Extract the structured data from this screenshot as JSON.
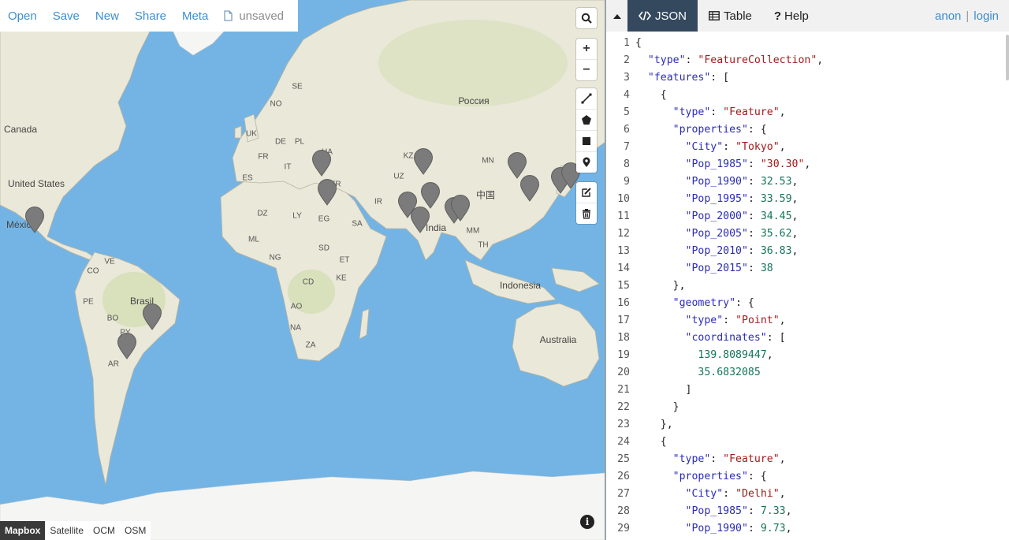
{
  "menu": {
    "items": [
      "Open",
      "Save",
      "New",
      "Share",
      "Meta"
    ],
    "doc_status": "unsaved"
  },
  "map": {
    "labels": [
      "Россия",
      "Canada",
      "United States",
      "México",
      "Brasil",
      "India",
      "中国",
      "Indonesia",
      "Australia",
      "SE",
      "NO",
      "UK",
      "DE",
      "PL",
      "UA",
      "FR",
      "ES",
      "IT",
      "TR",
      "KZ",
      "UZ",
      "MN",
      "IR",
      "DZ",
      "LY",
      "EG",
      "SA",
      "ML",
      "NG",
      "SD",
      "ET",
      "CD",
      "KE",
      "AO",
      "NA",
      "ZA",
      "VE",
      "CO",
      "PE",
      "BO",
      "PY",
      "AR",
      "MM",
      "TH"
    ],
    "base_layers": [
      "Mapbox",
      "Satellite",
      "OCM",
      "OSM"
    ],
    "active_layer": "Mapbox",
    "marker_color": "#7b7b7b",
    "water_color": "#74b4e4",
    "zoom_in": "+",
    "zoom_out": "−",
    "info": "i"
  },
  "panel": {
    "tabs": [
      "JSON",
      "Table",
      "Help"
    ],
    "active_tab": "JSON",
    "user": {
      "name": "anon",
      "login": "login"
    },
    "accent": "#34495e",
    "lines": [
      [
        [
          "p",
          "{"
        ]
      ],
      [
        [
          "p",
          "  "
        ],
        [
          "k",
          "\"type\""
        ],
        [
          "p",
          ": "
        ],
        [
          "s",
          "\"FeatureCollection\""
        ],
        [
          "p",
          ","
        ]
      ],
      [
        [
          "p",
          "  "
        ],
        [
          "k",
          "\"features\""
        ],
        [
          "p",
          ": ["
        ]
      ],
      [
        [
          "p",
          "    {"
        ]
      ],
      [
        [
          "p",
          "      "
        ],
        [
          "k",
          "\"type\""
        ],
        [
          "p",
          ": "
        ],
        [
          "s",
          "\"Feature\""
        ],
        [
          "p",
          ","
        ]
      ],
      [
        [
          "p",
          "      "
        ],
        [
          "k",
          "\"properties\""
        ],
        [
          "p",
          ": {"
        ]
      ],
      [
        [
          "p",
          "        "
        ],
        [
          "k",
          "\"City\""
        ],
        [
          "p",
          ": "
        ],
        [
          "s",
          "\"Tokyo\""
        ],
        [
          "p",
          ","
        ]
      ],
      [
        [
          "p",
          "        "
        ],
        [
          "k",
          "\"Pop_1985\""
        ],
        [
          "p",
          ": "
        ],
        [
          "s",
          "\"30.30\""
        ],
        [
          "p",
          ","
        ]
      ],
      [
        [
          "p",
          "        "
        ],
        [
          "k",
          "\"Pop_1990\""
        ],
        [
          "p",
          ": "
        ],
        [
          "n",
          "32.53"
        ],
        [
          "p",
          ","
        ]
      ],
      [
        [
          "p",
          "        "
        ],
        [
          "k",
          "\"Pop_1995\""
        ],
        [
          "p",
          ": "
        ],
        [
          "n",
          "33.59"
        ],
        [
          "p",
          ","
        ]
      ],
      [
        [
          "p",
          "        "
        ],
        [
          "k",
          "\"Pop_2000\""
        ],
        [
          "p",
          ": "
        ],
        [
          "n",
          "34.45"
        ],
        [
          "p",
          ","
        ]
      ],
      [
        [
          "p",
          "        "
        ],
        [
          "k",
          "\"Pop_2005\""
        ],
        [
          "p",
          ": "
        ],
        [
          "n",
          "35.62"
        ],
        [
          "p",
          ","
        ]
      ],
      [
        [
          "p",
          "        "
        ],
        [
          "k",
          "\"Pop_2010\""
        ],
        [
          "p",
          ": "
        ],
        [
          "n",
          "36.83"
        ],
        [
          "p",
          ","
        ]
      ],
      [
        [
          "p",
          "        "
        ],
        [
          "k",
          "\"Pop_2015\""
        ],
        [
          "p",
          ": "
        ],
        [
          "n",
          "38"
        ]
      ],
      [
        [
          "p",
          "      },"
        ]
      ],
      [
        [
          "p",
          "      "
        ],
        [
          "k",
          "\"geometry\""
        ],
        [
          "p",
          ": {"
        ]
      ],
      [
        [
          "p",
          "        "
        ],
        [
          "k",
          "\"type\""
        ],
        [
          "p",
          ": "
        ],
        [
          "s",
          "\"Point\""
        ],
        [
          "p",
          ","
        ]
      ],
      [
        [
          "p",
          "        "
        ],
        [
          "k",
          "\"coordinates\""
        ],
        [
          "p",
          ": ["
        ]
      ],
      [
        [
          "p",
          "          "
        ],
        [
          "n",
          "139.8089447"
        ],
        [
          "p",
          ","
        ]
      ],
      [
        [
          "p",
          "          "
        ],
        [
          "n",
          "35.6832085"
        ]
      ],
      [
        [
          "p",
          "        ]"
        ]
      ],
      [
        [
          "p",
          "      }"
        ]
      ],
      [
        [
          "p",
          "    },"
        ]
      ],
      [
        [
          "p",
          "    {"
        ]
      ],
      [
        [
          "p",
          "      "
        ],
        [
          "k",
          "\"type\""
        ],
        [
          "p",
          ": "
        ],
        [
          "s",
          "\"Feature\""
        ],
        [
          "p",
          ","
        ]
      ],
      [
        [
          "p",
          "      "
        ],
        [
          "k",
          "\"properties\""
        ],
        [
          "p",
          ": {"
        ]
      ],
      [
        [
          "p",
          "        "
        ],
        [
          "k",
          "\"City\""
        ],
        [
          "p",
          ": "
        ],
        [
          "s",
          "\"Delhi\""
        ],
        [
          "p",
          ","
        ]
      ],
      [
        [
          "p",
          "        "
        ],
        [
          "k",
          "\"Pop_1985\""
        ],
        [
          "p",
          ": "
        ],
        [
          "n",
          "7.33"
        ],
        [
          "p",
          ","
        ]
      ],
      [
        [
          "p",
          "        "
        ],
        [
          "k",
          "\"Pop_1990\""
        ],
        [
          "p",
          ": "
        ],
        [
          "n",
          "9.73"
        ],
        [
          "p",
          ","
        ]
      ]
    ]
  }
}
